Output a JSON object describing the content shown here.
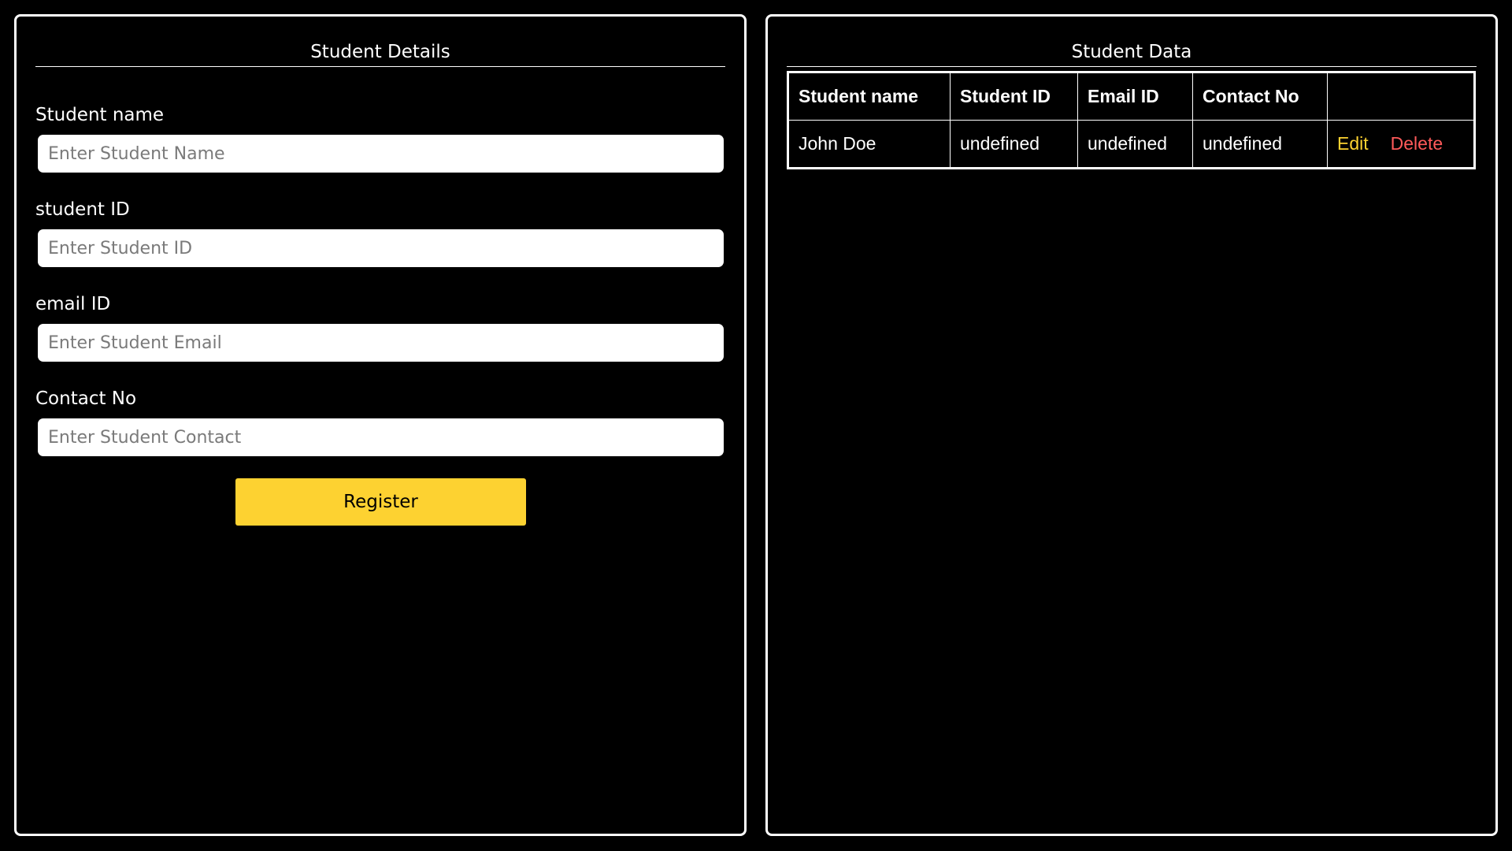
{
  "form_panel": {
    "title": "Student Details",
    "fields": [
      {
        "label": "Student name",
        "placeholder": "Enter Student Name",
        "value": ""
      },
      {
        "label": "student ID",
        "placeholder": "Enter Student ID",
        "value": ""
      },
      {
        "label": "email ID",
        "placeholder": "Enter Student Email",
        "value": ""
      },
      {
        "label": "Contact No",
        "placeholder": "Enter Student Contact",
        "value": ""
      }
    ],
    "register_label": "Register"
  },
  "data_panel": {
    "title": "Student Data",
    "columns": [
      "Student name",
      "Student ID",
      "Email ID",
      "Contact No",
      ""
    ],
    "rows": [
      {
        "name": "John Doe",
        "student_id": "undefined",
        "email": "undefined",
        "contact": "undefined",
        "edit_label": "Edit",
        "delete_label": "Delete"
      }
    ]
  },
  "colors": {
    "background": "#000000",
    "accent": "#fdd231",
    "delete": "#ff5a5a",
    "border": "#ffffff"
  }
}
